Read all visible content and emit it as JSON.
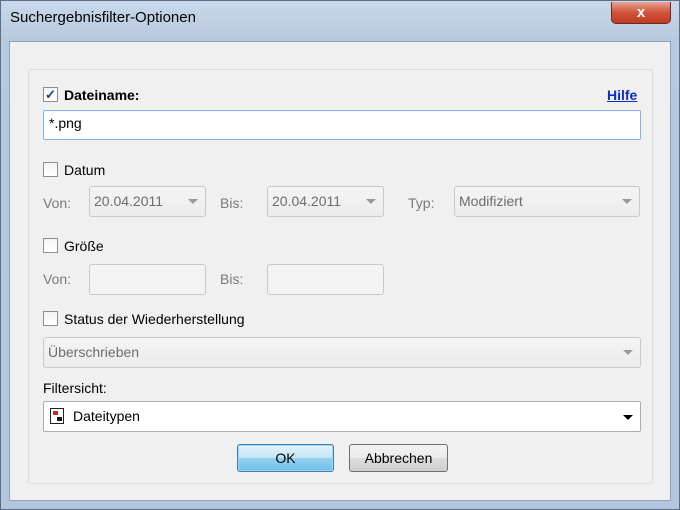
{
  "window": {
    "title": "Suchergebnisfilter-Optionen",
    "close_glyph": "x"
  },
  "filename": {
    "checked": true,
    "checkmark": "✓",
    "label": "Dateiname:",
    "value": "*.png",
    "help_link": "Hilfe"
  },
  "date": {
    "label": "Datum",
    "from_label": "Von:",
    "from_value": "20.04.2011",
    "to_label": "Bis:",
    "to_value": "20.04.2011",
    "type_label": "Typ:",
    "type_value": "Modifiziert"
  },
  "size": {
    "label": "Größe",
    "from_label": "Von:",
    "to_label": "Bis:"
  },
  "recovery": {
    "label": "Status der Wiederherstellung",
    "value": "Überschrieben"
  },
  "filter_view": {
    "label": "Filtersicht:",
    "value": "Dateitypen",
    "icon": "filetype-tree-icon"
  },
  "buttons": {
    "ok": "OK",
    "cancel": "Abbrechen"
  },
  "colors": {
    "link": "#0b2ccf",
    "focus_border": "#7eb4ea",
    "close_button": "#c8462e"
  }
}
